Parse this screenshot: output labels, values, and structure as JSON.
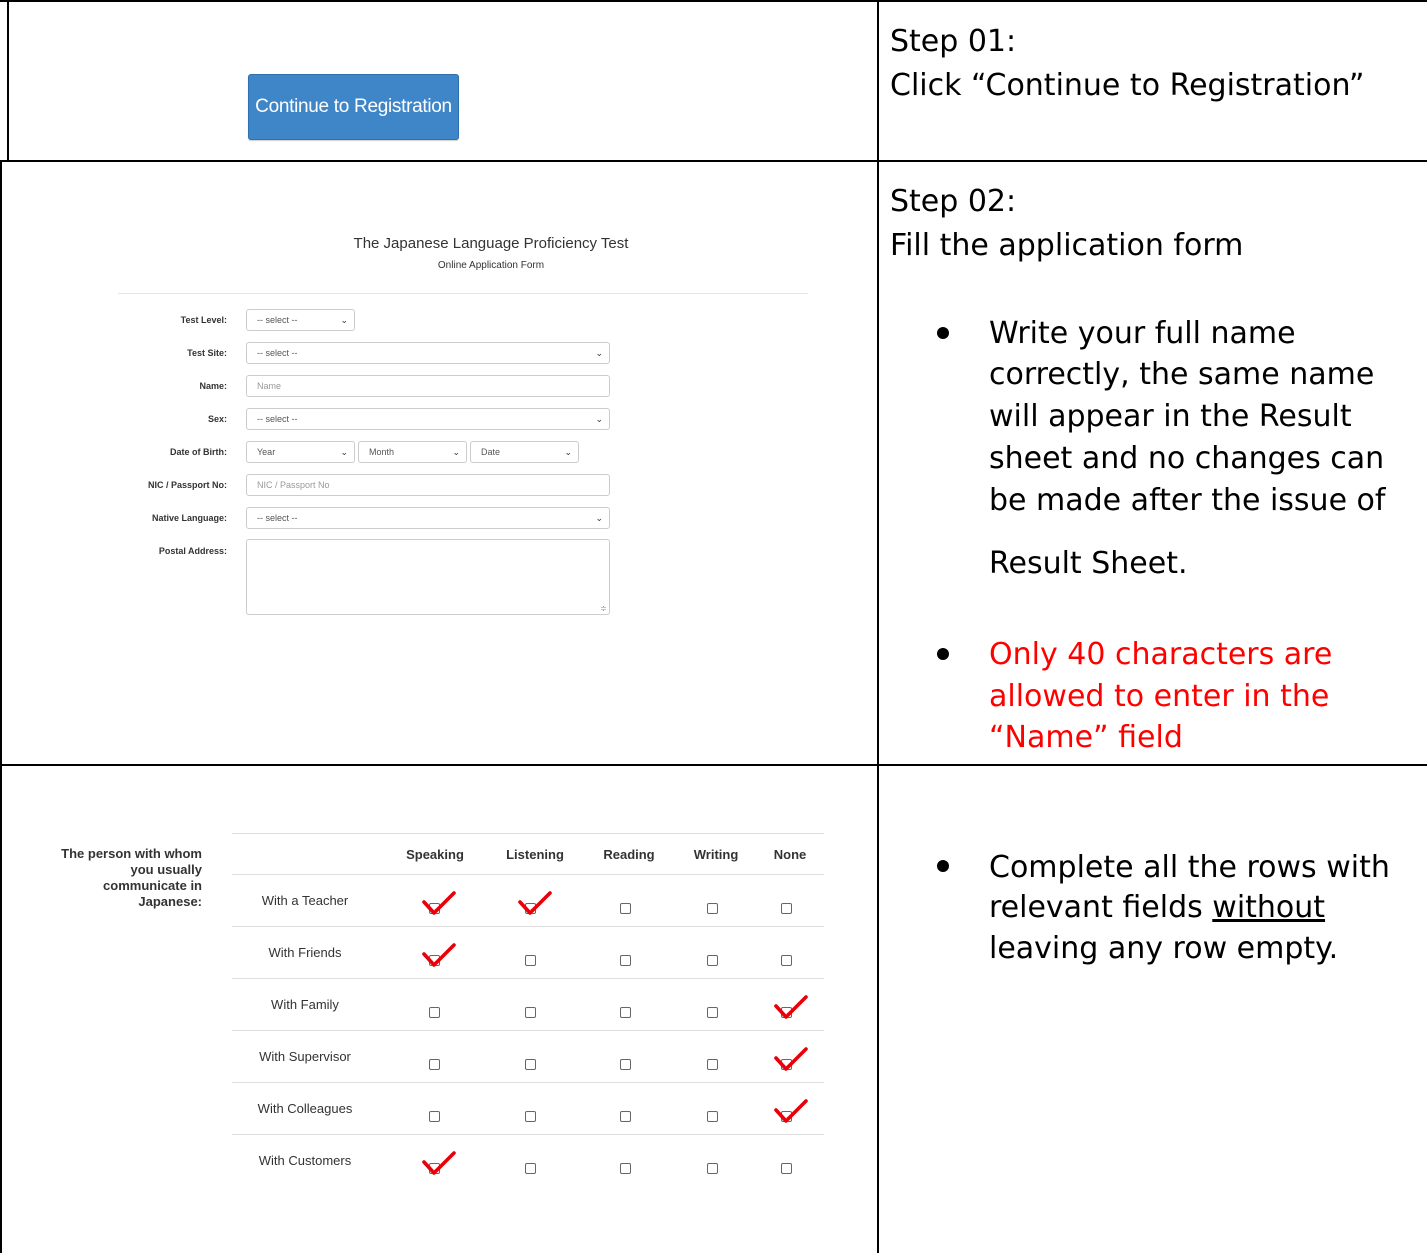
{
  "continue_button": {
    "label": "Continue to Registration"
  },
  "instructions": {
    "step1_heading": "Step 01:",
    "step1_text": "Click “Continue to Registration”",
    "step2_heading": "Step 02:",
    "step2_text": "Fill the application form",
    "bullet1_lines": [
      "Write your full name",
      "correctly, the same name",
      "will appear in the Result",
      "sheet and no changes can",
      "be made after the issue of",
      "Result Sheet."
    ],
    "bullet2_lines": [
      "Only 40 characters are",
      "allowed to enter in the",
      "“Name” field"
    ],
    "bullet3_line1": "Complete all the rows with",
    "bullet3_line2_underlined": "without",
    "bullet3_line2_prefix": "relevant fields ",
    "bullet3_line3": "leaving any row empty.",
    "bullet_colors": {
      "normal": "#000000",
      "warning": "#ff0000"
    }
  },
  "form": {
    "title": "The Japanese Language Proficiency Test",
    "subtitle": "Online Application Form",
    "fields": {
      "test_level": {
        "label": "Test Level:",
        "value": "-- select --"
      },
      "test_site": {
        "label": "Test Site:",
        "value": "-- select --"
      },
      "name": {
        "label": "Name:",
        "placeholder": "Name"
      },
      "sex": {
        "label": "Sex:",
        "value": "-- select --"
      },
      "dob": {
        "label": "Date of Birth:",
        "year": "Year",
        "month": "Month",
        "date": "Date"
      },
      "nic": {
        "label": "NIC / Passport No:",
        "placeholder": "NIC / Passport No"
      },
      "native_language": {
        "label": "Native Language:",
        "value": "-- select --"
      },
      "postal_address": {
        "label": "Postal Address:"
      }
    }
  },
  "communication": {
    "label_lines": [
      "The person with whom",
      "you usually",
      "communicate in",
      "Japanese:"
    ],
    "columns": [
      "Speaking",
      "Listening",
      "Reading",
      "Writing",
      "None"
    ],
    "rows": [
      {
        "label": "With a Teacher",
        "checked": [
          true,
          true,
          false,
          false,
          false
        ]
      },
      {
        "label": "With Friends",
        "checked": [
          true,
          false,
          false,
          false,
          false
        ]
      },
      {
        "label": "With Family",
        "checked": [
          false,
          false,
          false,
          false,
          true
        ]
      },
      {
        "label": "With Supervisor",
        "checked": [
          false,
          false,
          false,
          false,
          true
        ]
      },
      {
        "label": "With Colleagues",
        "checked": [
          false,
          false,
          false,
          false,
          true
        ]
      },
      {
        "label": "With Customers",
        "checked": [
          true,
          false,
          false,
          false,
          false
        ]
      }
    ],
    "tick_color": "#e8000b"
  }
}
